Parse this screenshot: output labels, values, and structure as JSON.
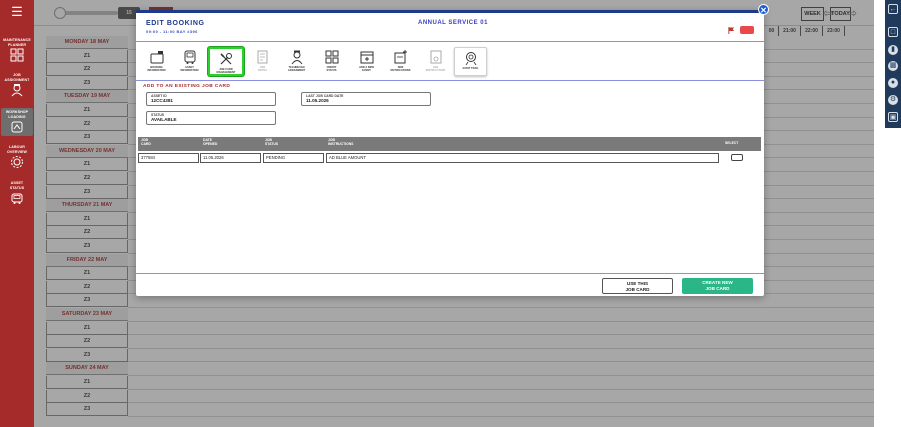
{
  "sidebar": {
    "menu_icon": "hamburger-icon",
    "items": [
      {
        "label": "MAINTENANCE\nPLANNER",
        "icon": "planner-grid-icon"
      },
      {
        "label": "JOB\nASSIGNMENT",
        "icon": "technician-icon"
      },
      {
        "label": "WORKSHOP\nLOADING",
        "icon": "workshop-loading-icon"
      },
      {
        "label": "LABOUR\nOVERVIEW",
        "icon": "labour-gear-icon"
      },
      {
        "label": "ASSET\nSTATUS",
        "icon": "vehicle-icon"
      }
    ]
  },
  "topbar": {
    "zoom_value": "15",
    "event_label": "EVENT T",
    "week_label": "WEEK",
    "today_label": "TODAY",
    "hours": [
      "00",
      "21:00",
      "22:00",
      "23:00"
    ]
  },
  "schedule": [
    {
      "kind": "day",
      "label": "MONDAY 18 MAY"
    },
    {
      "kind": "slot",
      "label": "Z1"
    },
    {
      "kind": "slot",
      "label": "Z2"
    },
    {
      "kind": "slot",
      "label": "Z3"
    },
    {
      "kind": "day",
      "label": "TUESDAY 19 MAY"
    },
    {
      "kind": "slot",
      "label": "Z1"
    },
    {
      "kind": "slot",
      "label": "Z2"
    },
    {
      "kind": "slot",
      "label": "Z3"
    },
    {
      "kind": "day",
      "label": "WEDNESDAY 20 MAY"
    },
    {
      "kind": "slot",
      "label": "Z1"
    },
    {
      "kind": "slot",
      "label": "Z2"
    },
    {
      "kind": "slot",
      "label": "Z3"
    },
    {
      "kind": "day",
      "label": "THURSDAY 21 MAY"
    },
    {
      "kind": "slot",
      "label": "Z1"
    },
    {
      "kind": "slot",
      "label": "Z2"
    },
    {
      "kind": "slot",
      "label": "Z3"
    },
    {
      "kind": "day",
      "label": "FRIDAY 22 MAY"
    },
    {
      "kind": "slot",
      "label": "Z1"
    },
    {
      "kind": "slot",
      "label": "Z2"
    },
    {
      "kind": "slot",
      "label": "Z3"
    },
    {
      "kind": "day",
      "label": "SATURDAY 23 MAY"
    },
    {
      "kind": "slot",
      "label": "Z1"
    },
    {
      "kind": "slot",
      "label": "Z2"
    },
    {
      "kind": "slot",
      "label": "Z3"
    },
    {
      "kind": "day",
      "label": "SUNDAY 24 MAY"
    },
    {
      "kind": "slot",
      "label": "Z1"
    },
    {
      "kind": "slot",
      "label": "Z2"
    },
    {
      "kind": "slot",
      "label": "Z3"
    }
  ],
  "modal": {
    "title": "EDIT BOOKING",
    "subtitle": "09:00 - 11:00   BAY #396",
    "center_title": "ANNUAL SERVICE 01",
    "tabs": [
      {
        "label": "BOOKING\nINFORMATION",
        "icon": "booking-info-icon",
        "state": "normal"
      },
      {
        "label": "ASSET\nINFORMATION",
        "icon": "asset-info-icon",
        "state": "normal"
      },
      {
        "label": "JOB CARD\nMANAGEMENT",
        "icon": "tools-icon",
        "state": "active"
      },
      {
        "label": "JOB\nNOTES",
        "icon": "job-notes-icon",
        "state": "disabled"
      },
      {
        "label": "TECHNICIAN\nASSIGNMENT",
        "icon": "technician-icon",
        "state": "normal"
      },
      {
        "label": "CREDIT\nSTATUS",
        "icon": "credit-status-icon",
        "state": "normal"
      },
      {
        "label": "ADD A NEW\nEVENT",
        "icon": "calendar-add-icon",
        "state": "normal"
      },
      {
        "label": "SMS\nNOTIFICATIONS",
        "icon": "sms-notification-icon",
        "state": "normal"
      },
      {
        "label": "JOB\nINSTRUCTIONS",
        "icon": "instructions-icon",
        "state": "disabled"
      },
      {
        "label": "AUDIT TRAIL",
        "icon": "audit-trail-icon",
        "state": "boxed"
      }
    ],
    "section_title": "ADD TO AN EXISTING JOB CARD",
    "fields": {
      "asset_id": {
        "label": "ASSET ID",
        "value": "12CC4381"
      },
      "last_job_card_date": {
        "label": "LAST JOB CARD DATE",
        "value": "11.05.2026"
      },
      "status": {
        "label": "STATUS",
        "value": "AVAILABLE"
      }
    },
    "table": {
      "headers": [
        "JOB\nCARD",
        "DATE\nOPENED",
        "JOB\nSTATUS",
        "JOB\nINSTRUCTIONS",
        "SELECT"
      ],
      "rows": [
        {
          "job_card": "377584",
          "date_opened": "11.05.2026",
          "job_status": "PENDING",
          "instructions": "AD BLUE AMOUNT"
        }
      ]
    },
    "buttons": {
      "use_this": "USE THIS\nJOB CARD",
      "create_new": "CREATE NEW\nJOB CARD"
    },
    "colors": {
      "accent": "#1f3a8a",
      "brand": "#a52a2a",
      "create": "#2bb688",
      "highlight": "#2bd12b"
    }
  },
  "right_rail": {
    "icons": [
      "collapse-arrow-icon",
      "chat-icon",
      "document-icon",
      "print-icon",
      "vehicle-icon",
      "settings-icon",
      "panel-icon"
    ]
  }
}
